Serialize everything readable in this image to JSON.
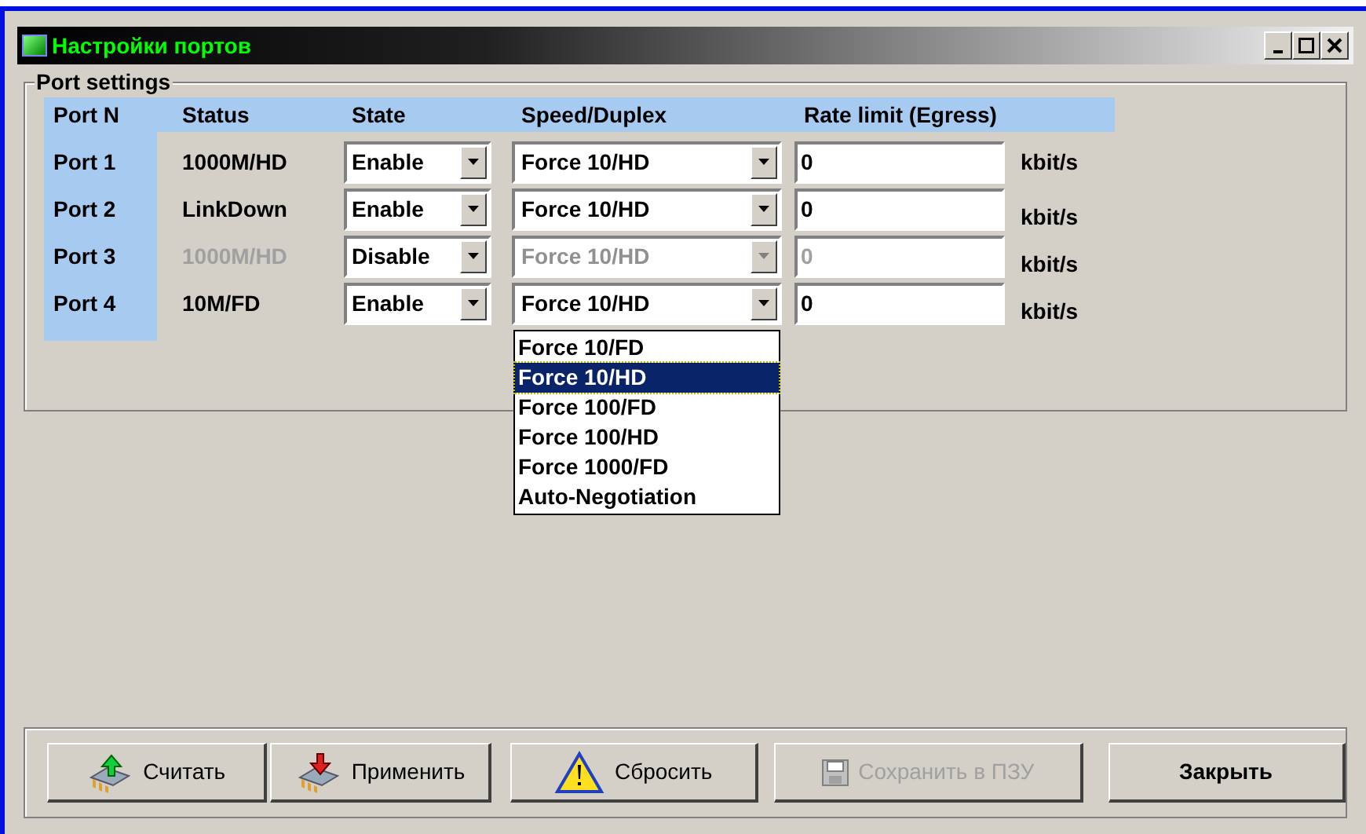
{
  "window": {
    "title": "Настройки портов"
  },
  "group": {
    "title": "Port settings"
  },
  "columns": [
    "Port N",
    "Status",
    "State",
    "Speed/Duplex",
    "Rate limit (Egress)"
  ],
  "ports": [
    {
      "name": "Port 1",
      "status": "1000M/HD",
      "state": "Enable",
      "speed": "Force 10/HD",
      "rate": "0",
      "unit": "kbit/s",
      "disabled": false
    },
    {
      "name": "Port 2",
      "status": "LinkDown",
      "state": "Enable",
      "speed": "Force 10/HD",
      "rate": "0",
      "unit": "kbit/s",
      "disabled": false
    },
    {
      "name": "Port 3",
      "status": "1000M/HD",
      "state": "Disable",
      "speed": "Force 10/HD",
      "rate": "0",
      "unit": "kbit/s",
      "disabled": true
    },
    {
      "name": "Port 4",
      "status": "10M/FD",
      "state": "Enable",
      "speed": "Force 10/HD",
      "rate": "0",
      "unit": "kbit/s",
      "disabled": false
    }
  ],
  "speed_options": [
    {
      "label": "Force 10/FD",
      "selected": false
    },
    {
      "label": "Force 10/HD",
      "selected": true
    },
    {
      "label": "Force 100/FD",
      "selected": false
    },
    {
      "label": "Force 100/HD",
      "selected": false
    },
    {
      "label": "Force 1000/FD",
      "selected": false
    },
    {
      "label": "Auto-Negotiation",
      "selected": false
    }
  ],
  "buttons": [
    {
      "kind": "read",
      "label": "Считать",
      "disabled": false
    },
    {
      "kind": "apply",
      "label": "Применить",
      "disabled": false
    },
    {
      "kind": "reset",
      "label": "Сбросить",
      "disabled": false
    },
    {
      "kind": "save",
      "label": "Сохранить в ПЗУ",
      "disabled": true
    },
    {
      "kind": "close",
      "label": "Закрыть",
      "disabled": false
    }
  ]
}
